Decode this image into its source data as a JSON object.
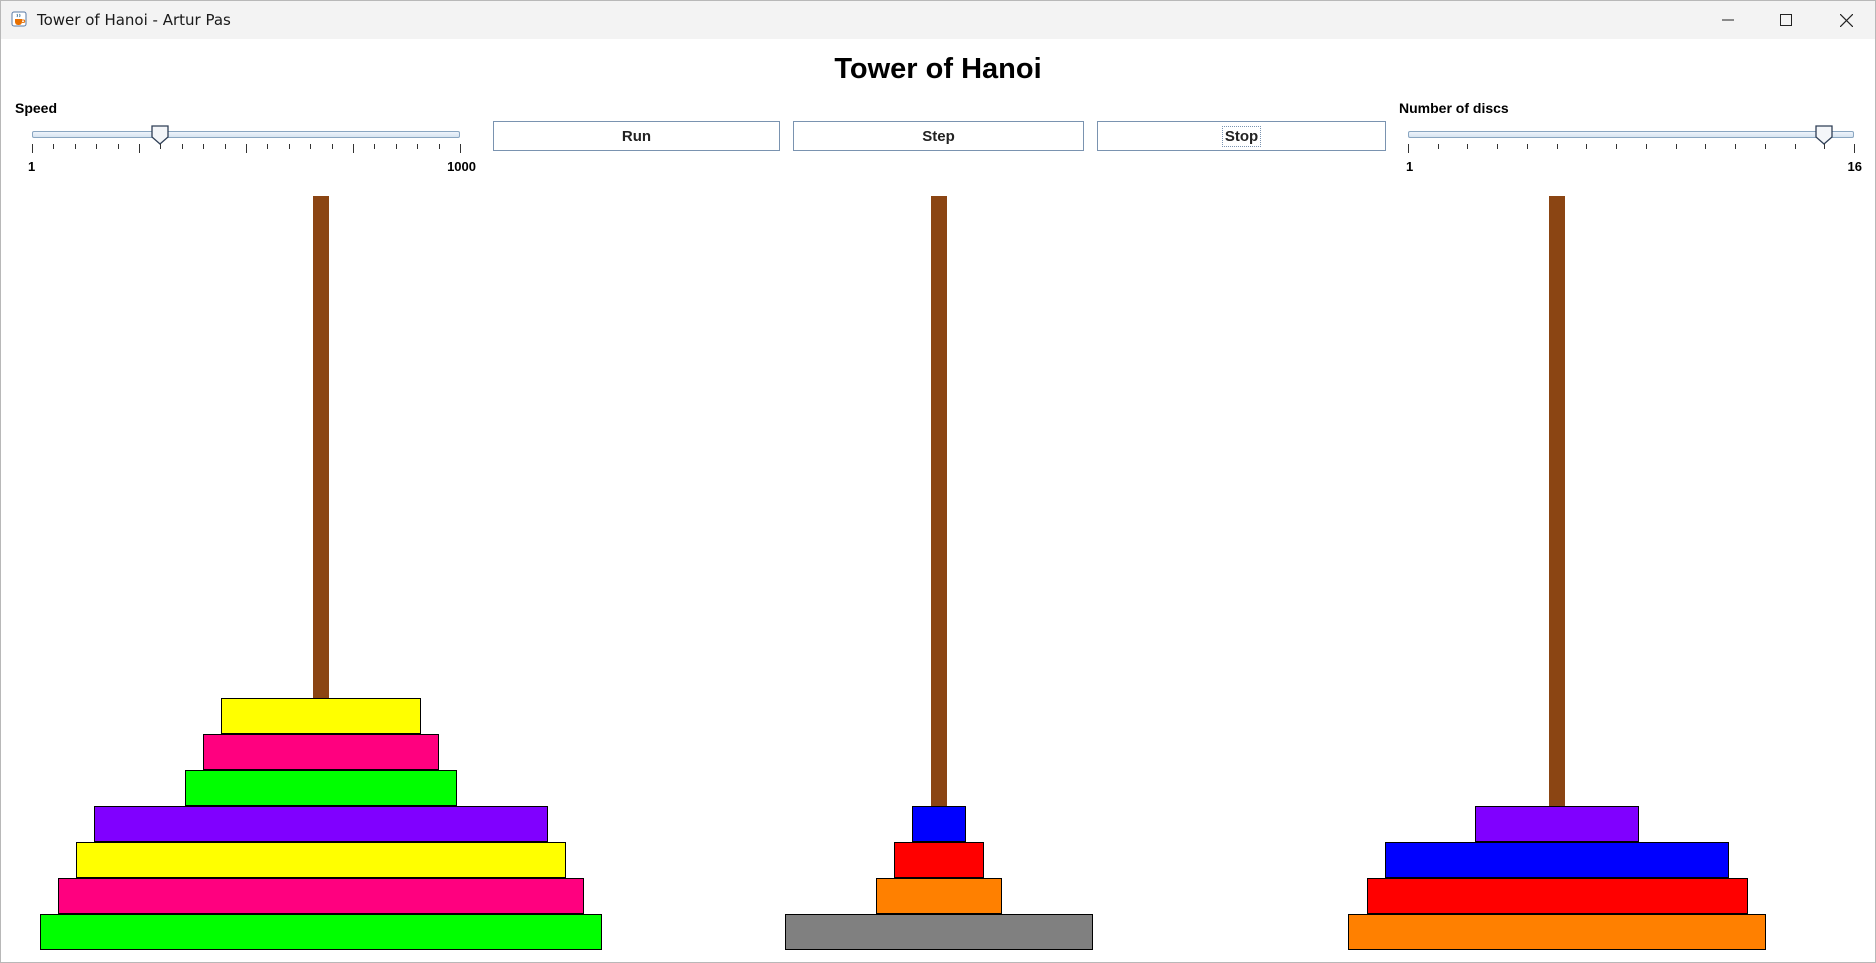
{
  "window": {
    "title": "Tower of Hanoi - Artur Pas",
    "icon": "java-cup-icon",
    "controls": [
      "minimize-icon",
      "maximize-icon",
      "close-icon"
    ]
  },
  "page": {
    "title": "Tower of Hanoi"
  },
  "speed": {
    "label": "Speed",
    "min_label": "1",
    "max_label": "1000",
    "min": 1,
    "max": 1000,
    "value": 300
  },
  "buttons": {
    "run": "Run",
    "step": "Step",
    "stop": "Stop"
  },
  "discs_control": {
    "label": "Number of discs",
    "min_label": "1",
    "max_label": "16",
    "min": 1,
    "max": 16,
    "value": 15
  },
  "colors": {
    "peg": "#8b4513",
    "slider_track": "#8aa6c1"
  },
  "pegs": [
    {
      "discs": [
        {
          "size": 15,
          "color": "#00ff00"
        },
        {
          "size": 14,
          "color": "#ff007f"
        },
        {
          "size": 13,
          "color": "#ffff00"
        },
        {
          "size": 12,
          "color": "#8000ff"
        },
        {
          "size": 7,
          "color": "#00ff00"
        },
        {
          "size": 6,
          "color": "#ff007f"
        },
        {
          "size": 5,
          "color": "#ffff00"
        }
      ]
    },
    {
      "discs": [
        {
          "size": 8,
          "color": "#808080"
        },
        {
          "size": 3,
          "color": "#ff8000"
        },
        {
          "size": 2,
          "color": "#ff0000"
        },
        {
          "size": 1,
          "color": "#0000ff"
        }
      ]
    },
    {
      "discs": [
        {
          "size": 11,
          "color": "#ff8000"
        },
        {
          "size": 10,
          "color": "#ff0000"
        },
        {
          "size": 9,
          "color": "#0000ff"
        },
        {
          "size": 4,
          "color": "#8000ff"
        }
      ]
    }
  ]
}
